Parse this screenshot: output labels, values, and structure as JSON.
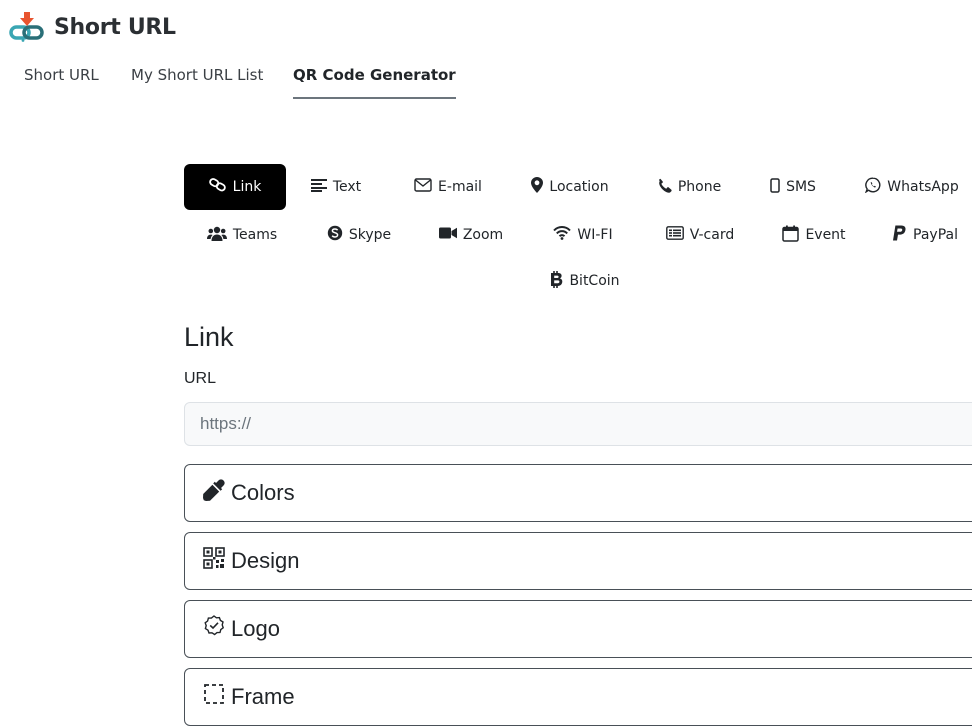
{
  "brand": {
    "name": "Short URL",
    "logo_icon": "chain-link-download-icon"
  },
  "nav": {
    "tabs": [
      {
        "label": "Short URL",
        "active": false
      },
      {
        "label": "My Short URL List",
        "active": false
      },
      {
        "label": "QR Code Generator",
        "active": true
      }
    ]
  },
  "qr_types": [
    {
      "label": "Link",
      "icon": "link-icon",
      "active": true
    },
    {
      "label": "Text",
      "icon": "text-lines-icon"
    },
    {
      "label": "E-mail",
      "icon": "envelope-icon"
    },
    {
      "label": "Location",
      "icon": "map-pin-icon"
    },
    {
      "label": "Phone",
      "icon": "phone-icon"
    },
    {
      "label": "SMS",
      "icon": "mobile-icon"
    },
    {
      "label": "WhatsApp",
      "icon": "whatsapp-icon"
    },
    {
      "label": "Teams",
      "icon": "users-icon"
    },
    {
      "label": "Skype",
      "icon": "skype-icon"
    },
    {
      "label": "Zoom",
      "icon": "video-camera-icon"
    },
    {
      "label": "WI-FI",
      "icon": "wifi-icon"
    },
    {
      "label": "V-card",
      "icon": "vcard-icon"
    },
    {
      "label": "Event",
      "icon": "calendar-icon"
    },
    {
      "label": "PayPal",
      "icon": "paypal-icon"
    },
    {
      "label": "BitCoin",
      "icon": "bitcoin-icon"
    }
  ],
  "form": {
    "section_title": "Link",
    "url_label": "URL",
    "url_placeholder": "https://",
    "url_value": ""
  },
  "accordions": [
    {
      "label": "Colors",
      "icon": "eyedropper-icon"
    },
    {
      "label": "Design",
      "icon": "qr-code-icon"
    },
    {
      "label": "Logo",
      "icon": "badge-check-icon"
    },
    {
      "label": "Frame",
      "icon": "dashed-frame-icon"
    }
  ]
}
